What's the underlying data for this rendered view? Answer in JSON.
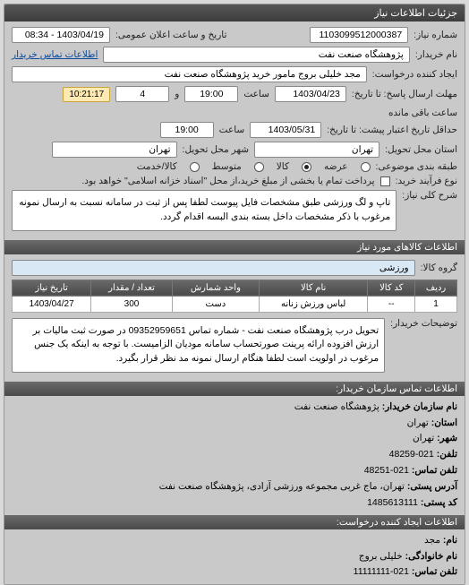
{
  "header": {
    "title": "جزئیات اطلاعات نیاز"
  },
  "need": {
    "number_label": "شماره نیاز:",
    "number_value": "1103099512000387",
    "announce_label": "تاریخ و ساعت اعلان عمومی:",
    "announce_value": "1403/04/19 - 08:34",
    "buyer_label": "نام خریدار:",
    "buyer_value": "پژوهشگاه صنعت نفت",
    "buyer_contact_label": "اطلاعات تماس خریدار",
    "creator_label": "ایجاد کننده درخواست:",
    "creator_value": "مجد خلیلی بروج مامور خرید پژوهشگاه صنعت نفت",
    "deadline_to_label": "مهلت ارسال پاسخ: تا تاریخ:",
    "deadline_date": "1403/04/23",
    "time_label": "ساعت",
    "deadline_time": "19:00",
    "and_label": "و",
    "deadline_remain_num": "4",
    "remaining_label": "ساعت باقی مانده",
    "countdown": "10:21:17",
    "validity_to_label": "حداقل تاریخ اعتبار پیشت: تا تاریخ:",
    "validity_date": "1403/05/31",
    "validity_time": "19:00",
    "delivery_state_label": "استان محل تحویل:",
    "delivery_state": "تهران",
    "delivery_city_label": "شهر محل تحویل:",
    "delivery_city": "تهران",
    "packaging_label": "طبقه بندی موضوعی:",
    "radio_high": "عرضه",
    "radio_goods": "کالا",
    "radio_medium": "متوسط",
    "radio_service": "کالا/خدمت",
    "agreement_label": "نوع فرآیند خرید:",
    "chk_partial": "پرداخت تمام یا بخشی از مبلغ خرید،از محل \"اسناد خزانه اسلامی\" خواهد بود.",
    "desc_label": "شرح کلی نیاز:",
    "desc_text": "تاپ و لگ ورزشی طبق مشخصات فایل پیوست لطفا پس از ثبت در سامانه نسبت به ارسال نمونه مرغوب با ذکر مشخصات داخل بسته بندی البسه اقدام گردد."
  },
  "goods": {
    "title": "اطلاعات کالاهای مورد نیاز",
    "group_label": "گروه کالا:",
    "group_value": "ورزشی",
    "headers": {
      "row": "ردیف",
      "code": "کد کالا",
      "name": "نام کالا",
      "unit": "واحد شمارش",
      "qty": "تعداد / مقدار",
      "date": "تاریخ نیاز"
    },
    "rows": [
      {
        "row": "1",
        "code": "--",
        "name": "لباس ورزش زنانه",
        "unit": "دست",
        "qty": "300",
        "date": "1403/04/27"
      }
    ],
    "notes_label": "توضیحات خریدار:",
    "notes_text": "تحویل درب پژوهشگاه صنعت نفت - شماره تماس 09352959651 در صورت ثبت مالیات بر ارزش افزوده ارائه پرینت صورتحساب سامانه مودیان الزامیست. با توجه به اینکه یک جنس مرغوب در اولویت است لطفا هنگام ارسال نمونه مد نظر قرار بگیرد."
  },
  "contact": {
    "title": "اطلاعات تماس سازمان خریدار:",
    "org_label": "نام سازمان خریدار:",
    "org_value": "پژوهشگاه صنعت نفت",
    "province_label": "استان:",
    "province_value": "تهران",
    "city_label": "شهر:",
    "city_value": "تهران",
    "phone_label": "تلفن:",
    "phone_value": "021-48259",
    "fax_label": "تلفن تماس:",
    "fax_value": "021-48251",
    "addr_label": "آدرس پستی:",
    "addr_value": "تهران، ماج غربی مجموعه ورزشی آزادی، پژوهشگاه صنعت نفت",
    "post_label": "کد پستی:",
    "post_value": "1485613111"
  },
  "requester": {
    "title": "اطلاعات ایجاد کننده درخواست:",
    "fname_label": "نام:",
    "fname_value": "مجد",
    "lname_label": "نام خانوادگی:",
    "lname_value": "خلیلی بروج",
    "phone_label": "تلفن تماس:",
    "phone_value": "021-11111111"
  }
}
